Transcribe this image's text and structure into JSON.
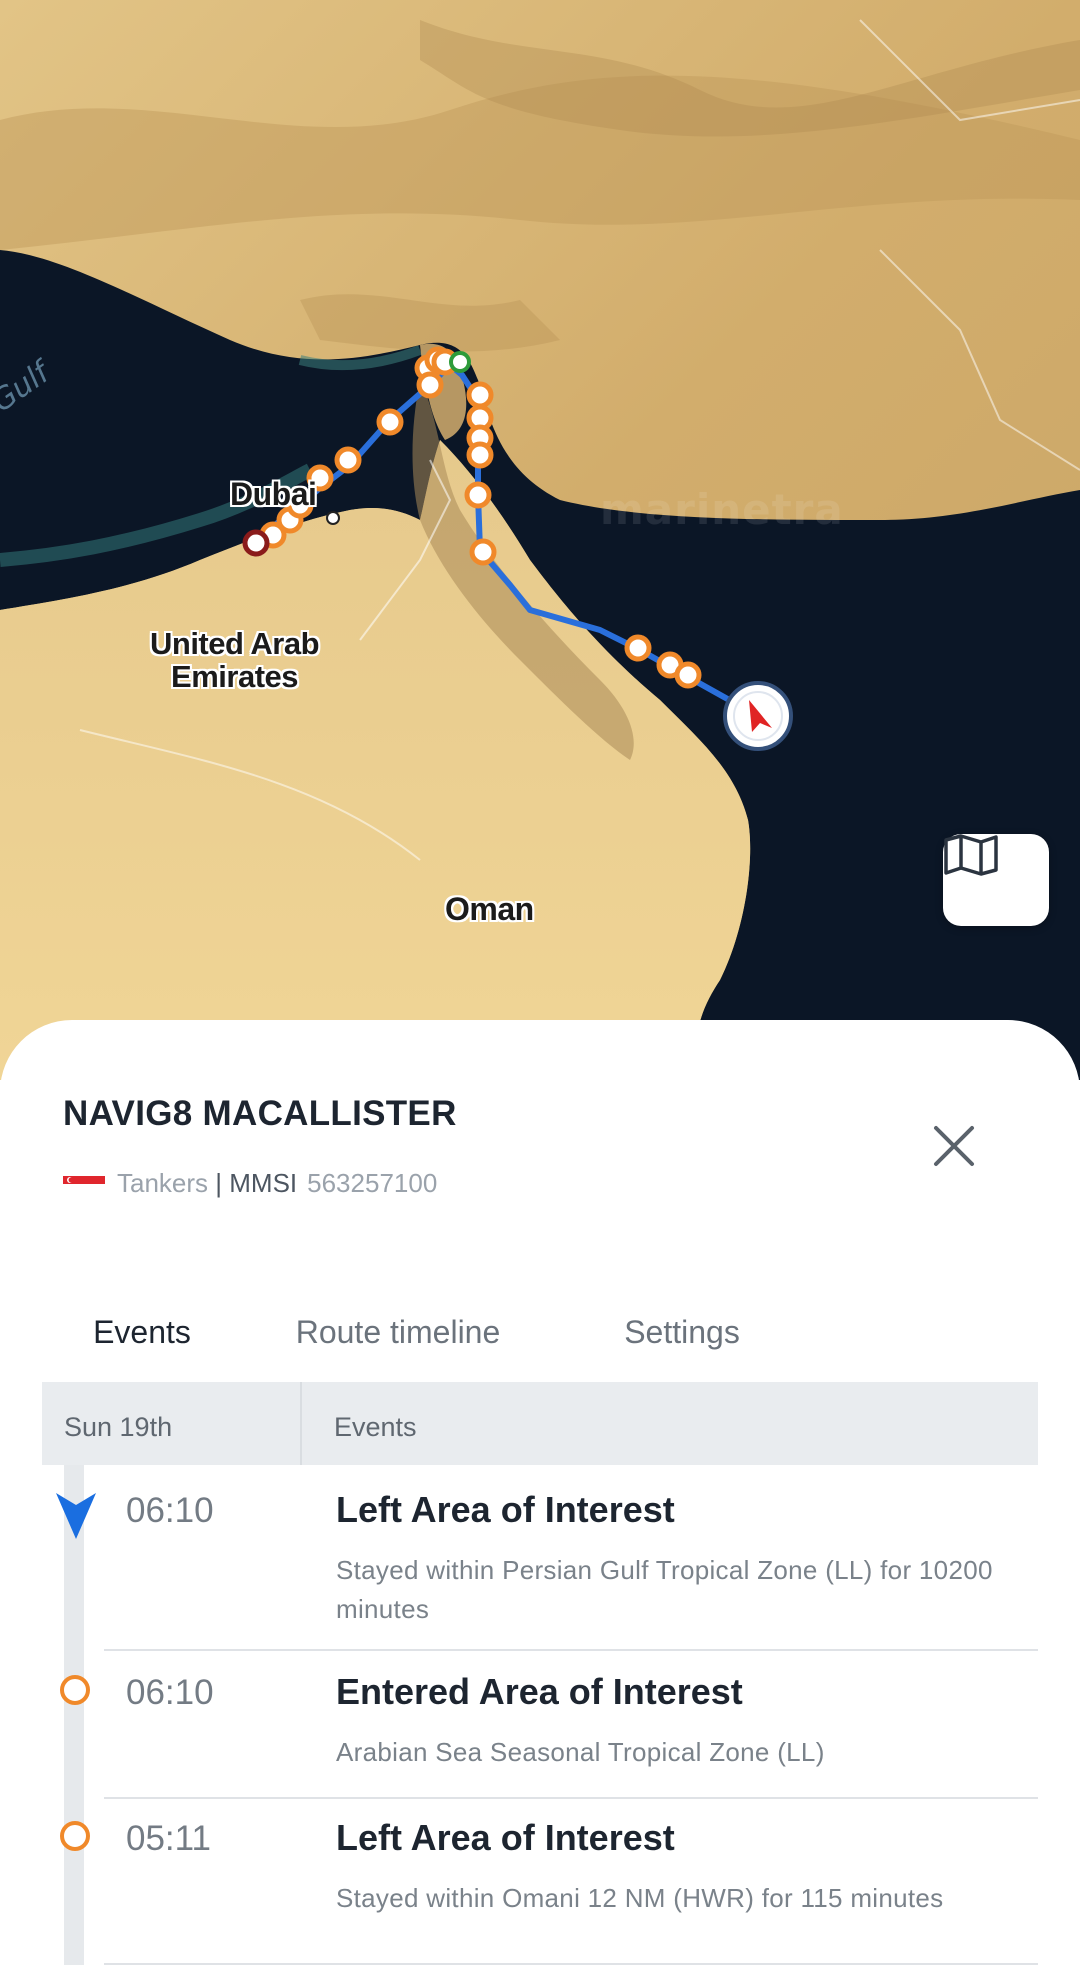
{
  "map": {
    "place_labels": {
      "dubai": "Dubai",
      "uae": "United Arab\nEmirates",
      "oman": "Oman"
    },
    "sea_label": "Gulf",
    "watermark": "marinetra",
    "layers_button_icon": "map-icon"
  },
  "vessel": {
    "name": "NAVIG8 MACALLISTER",
    "flag_icon": "singapore-flag-icon",
    "type": "Tankers",
    "separator": " | ",
    "mmsi_label": "MMSI",
    "mmsi": "563257100"
  },
  "tabs": [
    {
      "label": "Events",
      "active": true
    },
    {
      "label": "Route timeline",
      "active": false
    },
    {
      "label": "Settings",
      "active": false
    }
  ],
  "table": {
    "date_header": "Sun 19th",
    "events_header": "Events"
  },
  "events": [
    {
      "time": "06:10",
      "title": "Left Area of Interest",
      "description": "Stayed within Persian Gulf Tropical Zone (LL) for 10200 minutes",
      "marker": "current-position-icon"
    },
    {
      "time": "06:10",
      "title": "Entered Area of Interest",
      "description": "Arabian Sea Seasonal Tropical Zone (LL)",
      "marker": "event-circle-icon"
    },
    {
      "time": "05:11",
      "title": "Left Area of Interest",
      "description": "Stayed within Omani 12 NM (HWR) for 115 minutes",
      "marker": "event-circle-icon"
    }
  ],
  "colors": {
    "track": "#2a6fdb",
    "waypoint": "#f0892a",
    "sea": "#0b1626",
    "desert": "#d9b877",
    "vessel_arrow": "#e02424"
  }
}
